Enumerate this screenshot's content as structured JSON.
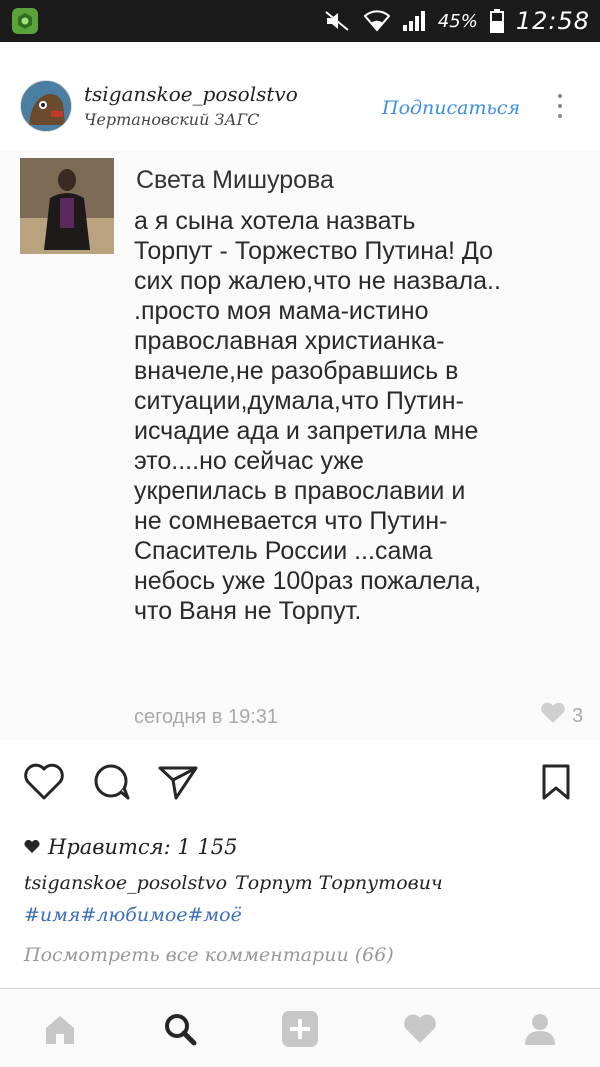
{
  "status_bar": {
    "battery": "45%",
    "time": "12:58"
  },
  "post": {
    "username": "tsiganskoe_posolstvo",
    "location": "Чертановский ЗАГС",
    "follow_label": "Подписаться"
  },
  "comment": {
    "author": "Света Мишурова",
    "text": "а я сына хотела назвать\nТорпут - Торжество Путина! До\nсих пор жалею,что не назвала..\n.просто моя мама-истино\nправославная христианка-\nвначеле,не разобравшись в\nситуации,думала,что Путин-\nисчадие ада и запретила мне\nэто....но сейчас уже\nукрепилась в православии и\nне сомневается что Путин-\nСпаситель России ...сама\nнебось уже 100раз пожалела,\nчто Ваня не Торпут.",
    "time": "сегодня в 19:31",
    "likes": "3"
  },
  "likes_line": "Нравится: 1 155",
  "caption": {
    "user": "tsiganskoe_posolstvo",
    "text": "Торпут Торпутович",
    "hashtags": "#имя#любимое#моё"
  },
  "view_comments": "Посмотреть все комментарии (66)",
  "colors": {
    "link": "#3d8de0",
    "hashtag": "#3d6fb8",
    "icon_gray": "#c7c7c7"
  },
  "icons": {
    "nav": [
      "home-icon",
      "search-icon",
      "add-icon",
      "heart-icon",
      "profile-icon"
    ],
    "actions": [
      "like-icon",
      "comment-icon",
      "share-icon",
      "bookmark-icon"
    ]
  }
}
